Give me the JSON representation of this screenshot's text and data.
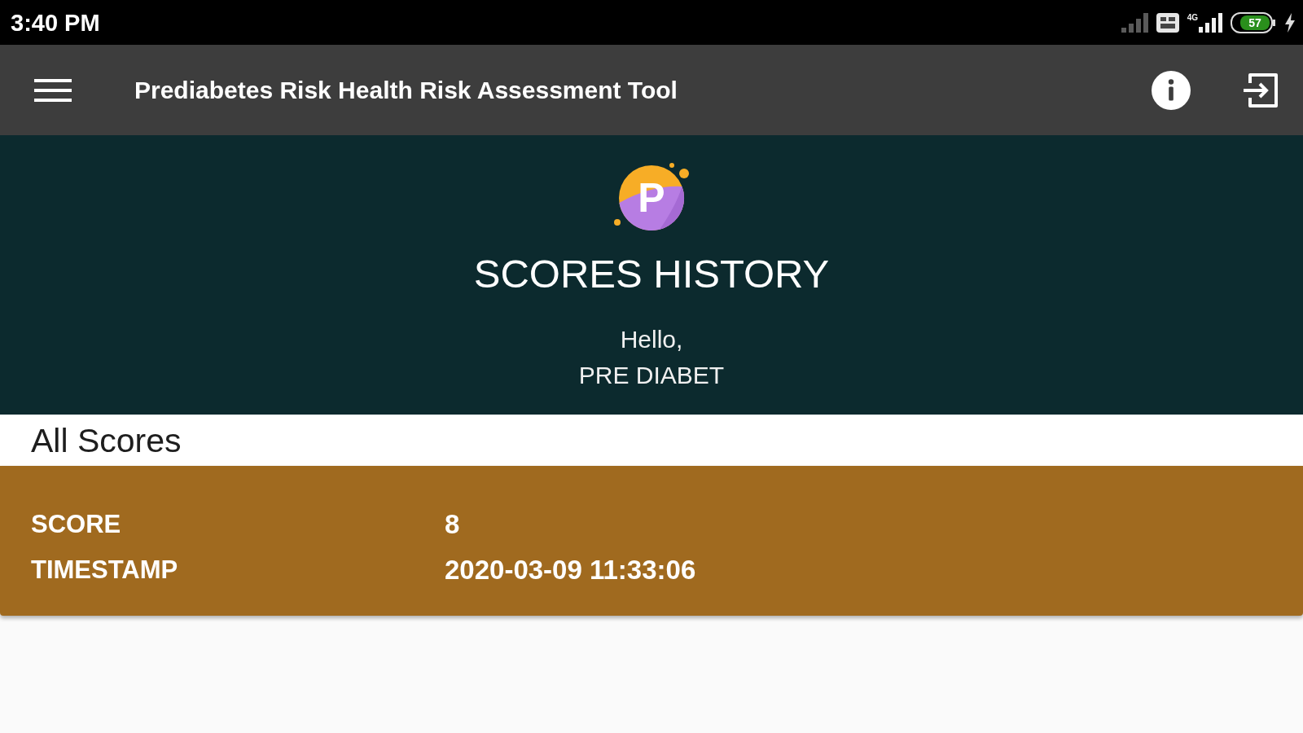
{
  "status_bar": {
    "time": "3:40 PM",
    "network_type": "4G",
    "battery_text": "57",
    "charging": true
  },
  "app_bar": {
    "title": "Prediabetes Risk Health Risk Assessment Tool"
  },
  "header": {
    "logo_letter": "P",
    "title": "SCORES HISTORY",
    "greeting": "Hello,",
    "user_name": "PRE DIABET"
  },
  "section": {
    "title": "All Scores"
  },
  "scores": [
    {
      "fields": [
        {
          "label": "SCORE",
          "value": "8"
        },
        {
          "label": "TIMESTAMP",
          "value": "2020-03-09 11:33:06"
        }
      ]
    }
  ]
}
